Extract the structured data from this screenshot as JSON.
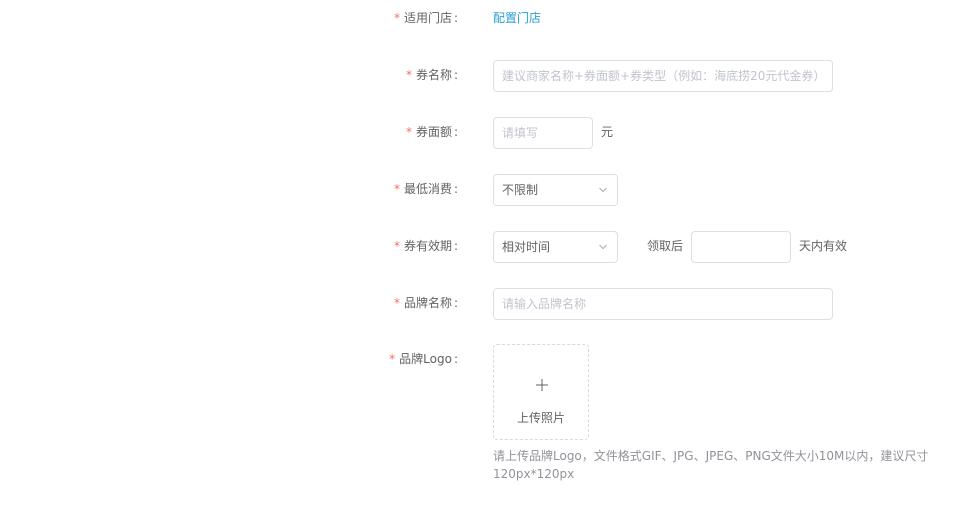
{
  "form": {
    "store": {
      "label": "适用门店",
      "link": "配置门店"
    },
    "coupon_name": {
      "label": "券名称",
      "placeholder": "建议商家名称+券面额+券类型（例如：海底捞20元代金券）"
    },
    "coupon_value": {
      "label": "券面额",
      "placeholder": "请填写",
      "unit": "元"
    },
    "min_spend": {
      "label": "最低消费",
      "selected": "不限制"
    },
    "validity": {
      "label": "券有效期",
      "selected": "相对时间",
      "after_label": "领取后",
      "days_value": "",
      "suffix": "天内有效"
    },
    "brand_name": {
      "label": "品牌名称",
      "placeholder": "请输入品牌名称"
    },
    "brand_logo": {
      "label": "品牌Logo",
      "upload_text": "上传照片",
      "hint": "请上传品牌Logo，文件格式GIF、JPG、JPEG、PNG文件大小10M以内，建议尺寸120px*120px"
    },
    "required_mark": "*",
    "colon": ":"
  },
  "icons": {
    "chevron": "chevron-down-icon",
    "plus": "plus-icon"
  },
  "colors": {
    "required": "#f56c6c",
    "link": "#2a9fd6",
    "border": "#dcdfe6",
    "placeholder": "#c0c4cc",
    "text": "#606266"
  }
}
